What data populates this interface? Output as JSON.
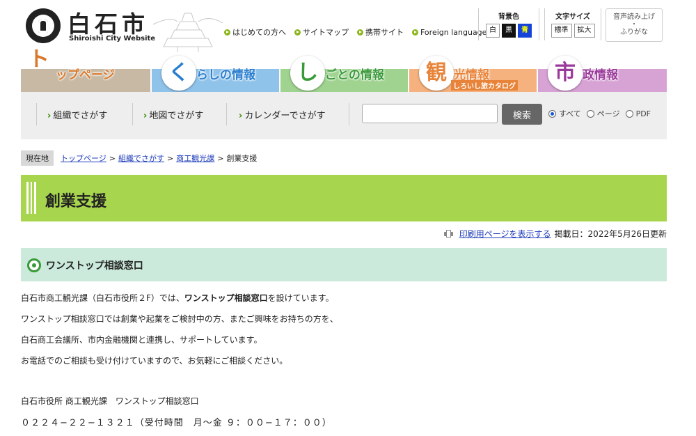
{
  "header": {
    "logo_title": "白石市",
    "logo_sub": "Shiroishi City Website",
    "links": [
      "はじめての方へ",
      "サイトマップ",
      "携帯サイト",
      "Foreign language"
    ],
    "bg_color": {
      "title": "背景色",
      "options": [
        "白",
        "黒",
        "青"
      ]
    },
    "font_size": {
      "title": "文字サイズ",
      "options": [
        "標準",
        "拡大"
      ]
    },
    "speech": {
      "line1": "音声読み上げ",
      "line2": "・",
      "line3": "ふりがな"
    }
  },
  "nav": {
    "tabs": [
      {
        "char": "ト",
        "label": "ップページ",
        "color": "#c7b9a3",
        "char_color": "#d9772a"
      },
      {
        "char": "く",
        "label": "らしの情報",
        "color": "#8fc3ea",
        "char_color": "#2a7ed0"
      },
      {
        "char": "し",
        "label": "ごとの情報",
        "color": "#9fd38f",
        "char_color": "#3a9a3a"
      },
      {
        "char": "観",
        "label": "光情報",
        "sub": "しろいし旅カタログ",
        "color": "#f5b27f",
        "char_color": "#e8843a"
      },
      {
        "char": "市",
        "label": "政情報",
        "color": "#d7a3d5",
        "char_color": "#9a3a9a"
      }
    ]
  },
  "search": {
    "links": [
      "組織でさがす",
      "地図でさがす",
      "カレンダーでさがす"
    ],
    "placeholder": "",
    "button": "検索",
    "scopes": [
      "すべて",
      "ページ",
      "PDF"
    ],
    "selected_scope": "すべて"
  },
  "breadcrumb": {
    "here": "現在地",
    "items": [
      "トップページ",
      "組織でさがす",
      "商工観光課"
    ],
    "current": "創業支援"
  },
  "page": {
    "title": "創業支援",
    "print_link": "印刷用ページを表示する",
    "updated": "掲載日：2022年5月26日更新",
    "section_title": "ワンストップ相談窓口",
    "p1_a": "白石市商工観光課（白石市役所２F）では、",
    "p1_b": "ワンストップ相談窓口",
    "p1_c": "を設けています。",
    "p2": "ワンストップ相談窓口では創業や起業をご検討中の方、またご興味をお持ちの方を、",
    "p3": "白石商工会議所、市内金融機関と連携し、サポートしています。",
    "p4": "お電話でのご相談も受け付けていますので、お気軽にご相談ください。",
    "p5": "白石市役所 商工観光課　ワンストップ相談窓口",
    "p6": "０２２４−２２−１３２１（受付時間　月〜金 ９：００−１７：００）"
  }
}
